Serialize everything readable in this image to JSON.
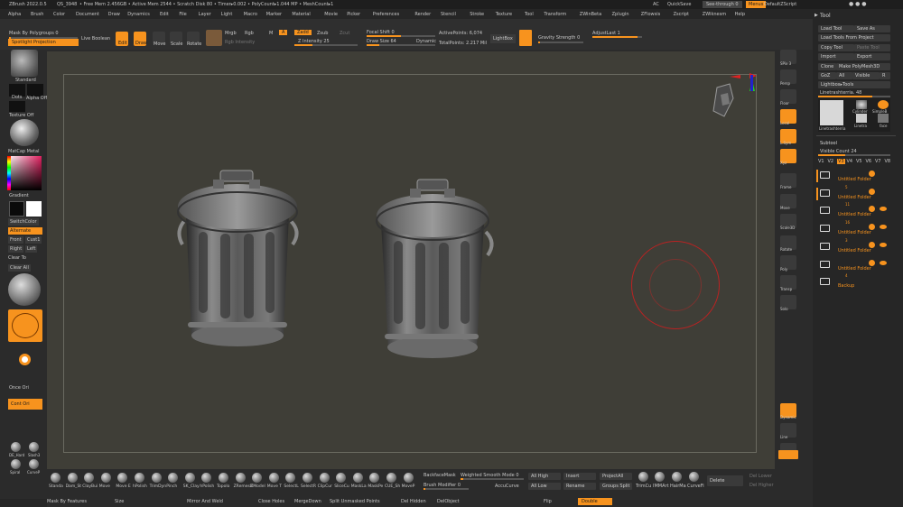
{
  "titlebar": {
    "app": "ZBrush 2022.0.5",
    "doc": "QS_3948",
    "stats": "• Free Mem 2.456GB • Active Mem 2544 • Scratch Disk 80 • Timer▸0.002 • PolyCount▸1.044 MP • MeshCount▸1",
    "ac": "AC",
    "quicksave": "QuickSave",
    "seethrough": "See-through  0",
    "menus": "Menus",
    "script": "DefaultZScript"
  },
  "menu_items": [
    "Alpha",
    "Brush",
    "Color",
    "Document",
    "Draw",
    "Dynamics",
    "Edit",
    "File",
    "Layer",
    "Light",
    "Macro",
    "Marker",
    "Material",
    "Movie",
    "Picker",
    "Preferences",
    "Render",
    "Stencil",
    "Stroke",
    "Texture",
    "Tool",
    "Transform",
    "ZWinBeta",
    "Zplugin",
    "ZFlowsis",
    "Zscript",
    "ZWiknesm",
    "Help"
  ],
  "toolbar": {
    "mask_by_polygroups": "Mask By Polygroups 0",
    "spotlight": "Spotlight Projection",
    "live_boolean": "Live Boolean",
    "edit": "Edit",
    "draw": "Draw",
    "move": "Move",
    "scale": "Scale",
    "rotate": "Rotate",
    "mrgb": "Mrgb",
    "rgb": "Rgb",
    "m": "M",
    "a": "A",
    "zadd": "Zadd",
    "zsub": "Zsub",
    "zcut": "Zcut",
    "rgb_intensity": "Rgb Intensity",
    "z_intensity": "Z Intensity 25",
    "focal_shift": "Focal Shift 0",
    "draw_size": "Draw Size 64",
    "dynamic": "Dynamic",
    "active_points": "ActivePoints: 6,074",
    "total_points": "TotalPoints: 2.217 Mil",
    "lightbox": "LightBox",
    "gravity": "Gravity Strength 0",
    "adjust_last": "AdjustLast 1"
  },
  "left_shelf": {
    "standard": "Standard",
    "dots": "Dots",
    "alpha_off": "Alpha Off",
    "texture_off": "Texture Off",
    "matcap": "MatCap Metal",
    "gradient": "Gradient",
    "switchcolor": "SwitchColor",
    "alternate": "Alternate",
    "front": "Front",
    "cust1": "Cust1",
    "right": "Right",
    "left": "Left",
    "clear_to": "Clear To",
    "clear_all": "Clear All",
    "once_ori": "Once Ori",
    "cont_ori": "Cont Ori",
    "dam": "DE_Hard",
    "slash": "Slash3",
    "spiral": "Spiral",
    "curvep": "CurveP"
  },
  "right_shelf": [
    "SPix 3",
    "Persp",
    "Floor",
    "Local",
    "L.Sym",
    "Xyz",
    "Frame",
    "Move",
    "Scale3D",
    "Rotate",
    "Poly",
    "Transp",
    "Solo",
    "Dynamic",
    "Line",
    "Spot",
    "Xpose"
  ],
  "tool_panel": {
    "title": "Tool",
    "load_tool": "Load Tool",
    "save_as": "Save As",
    "load_from_project": "Load Tools From Project",
    "copy_tool": "Copy Tool",
    "paste_tool": "Paste Tool",
    "import": "Import",
    "export": "Export",
    "clone": "Clone",
    "make_polymesh": "Make PolyMesh3D",
    "goz": "GoZ",
    "all": "All",
    "visible": "Visible",
    "r": "R",
    "lightbox_tools": "Lightbox▸Tools",
    "current_tool": "Linetrashterria. 48",
    "thumbs": [
      "Linetrashterria",
      "Cylinder",
      "SimpleB",
      "Linetra",
      "face"
    ],
    "subtool": "Subtool",
    "visible_count": "Visible Count 24",
    "v_tabs": [
      "V1",
      "V2",
      "V3",
      "V4",
      "V5",
      "V6",
      "V7",
      "V8"
    ],
    "folders": [
      "Untitled Folder",
      "Untitled Folder",
      "Untitled Folder",
      "Untitled Folder",
      "Untitled Folder",
      "Untitled Folder",
      "Backup"
    ],
    "folder_counts": [
      "",
      "5",
      "11",
      "16",
      "3",
      "",
      "4"
    ]
  },
  "bottom": {
    "brushes": [
      "Standa",
      "Dam_St",
      "ClayBui",
      "Move",
      "Move E",
      "hPolish",
      "TrimDyn",
      "Pinch",
      "SK_Clay",
      "hPolish",
      "Topolo",
      "ZRemesh",
      "ZModel",
      "Move T",
      "SelectL",
      "SelectR",
      "ClipCur",
      "SliceCu",
      "MaskLa",
      "MaskPe",
      "CUE_Sh",
      "MoveP"
    ],
    "backface": "BackfaceMask",
    "weighted": "Weighted Smooth Mode 0",
    "brush_modifier": "Brush Modifier 0",
    "accucurve": "AccuCurve",
    "all_high": "All High",
    "all_low": "All Low",
    "insert": "Insert",
    "rename": "Rename",
    "project_all": "ProjectAll",
    "groups_split": "Groups Split",
    "trimcu": "TrimCu",
    "imm": "IMMArt",
    "hairma": "HairMa",
    "curvefi": "CurveFi",
    "delete": "Delete",
    "del_lower": "Del Lower",
    "del_higher": "Del Higher",
    "mask_by_features": "Mask By Features",
    "size": "Size",
    "mirror_and_weld": "Mirror And Weld",
    "close_holes": "Close Holes",
    "merge_down": "MergeDown",
    "split_unmasked": "Split Unmasked Points",
    "del_hidden": "Del Hidden",
    "del_object": "DelObject",
    "flip": "Flip",
    "double": "Double"
  },
  "colors": {
    "accent": "#f7931e",
    "canvas": "#3f3e37",
    "panel": "#2b2b2b"
  }
}
